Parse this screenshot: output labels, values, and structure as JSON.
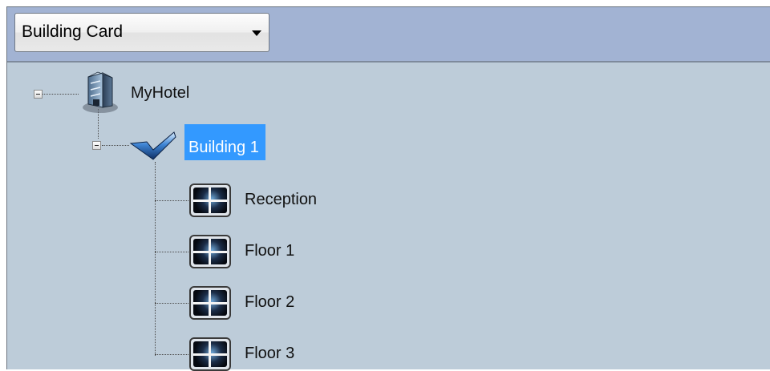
{
  "toolbar": {
    "combo": {
      "selected": "Building Card"
    }
  },
  "tree": {
    "root": {
      "label": "MyHotel",
      "icon": "hotel-building-icon",
      "expanded": true
    },
    "building": {
      "label": "Building 1",
      "icon": "checkmark-icon",
      "expanded": true,
      "selected": true
    },
    "floors": [
      {
        "label": "Reception",
        "icon": "floor-plan-icon"
      },
      {
        "label": "Floor 1",
        "icon": "floor-plan-icon"
      },
      {
        "label": "Floor 2",
        "icon": "floor-plan-icon"
      },
      {
        "label": "Floor 3",
        "icon": "floor-plan-icon"
      }
    ]
  },
  "colors": {
    "toolbar_bg": "#a2b3d3",
    "tree_bg": "#bdccd9",
    "selection": "#3399ff"
  }
}
